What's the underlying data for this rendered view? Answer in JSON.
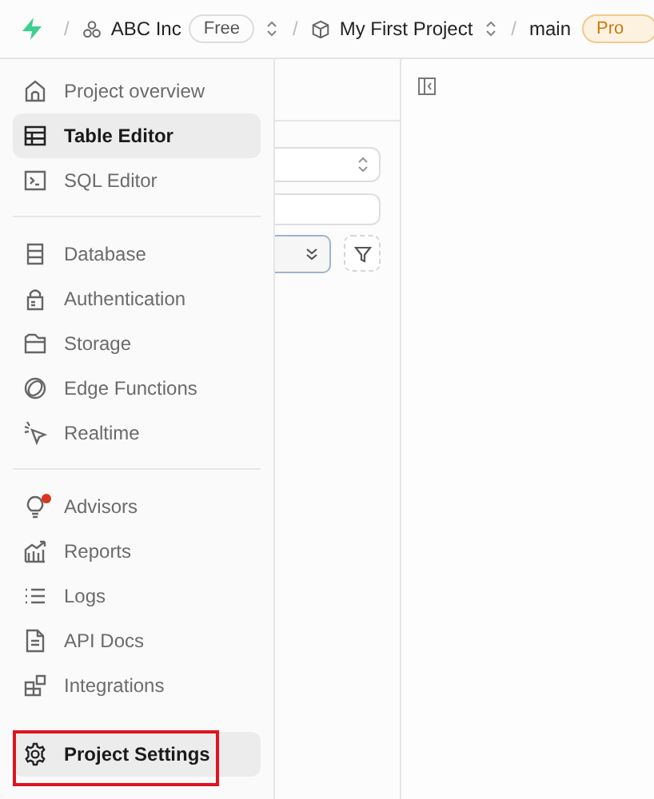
{
  "breadcrumb": {
    "separators": [
      "/",
      "/",
      "/"
    ],
    "org": {
      "name": "ABC Inc",
      "plan": "Free"
    },
    "project": {
      "name": "My First Project"
    },
    "branch": {
      "name": "main",
      "badge": "Pro"
    }
  },
  "sidebar": {
    "groups": [
      [
        {
          "label": "Project overview",
          "selected": false,
          "highlighted": false,
          "alert": false
        },
        {
          "label": "Table Editor",
          "selected": true,
          "highlighted": false,
          "alert": false
        },
        {
          "label": "SQL Editor",
          "selected": false,
          "highlighted": false,
          "alert": false
        }
      ],
      [
        {
          "label": "Database",
          "selected": false,
          "highlighted": false,
          "alert": false
        },
        {
          "label": "Authentication",
          "selected": false,
          "highlighted": false,
          "alert": false
        },
        {
          "label": "Storage",
          "selected": false,
          "highlighted": false,
          "alert": false
        },
        {
          "label": "Edge Functions",
          "selected": false,
          "highlighted": false,
          "alert": false
        },
        {
          "label": "Realtime",
          "selected": false,
          "highlighted": false,
          "alert": false
        }
      ],
      [
        {
          "label": "Advisors",
          "selected": false,
          "highlighted": false,
          "alert": true
        },
        {
          "label": "Reports",
          "selected": false,
          "highlighted": false,
          "alert": false
        },
        {
          "label": "Logs",
          "selected": false,
          "highlighted": false,
          "alert": false
        },
        {
          "label": "API Docs",
          "selected": false,
          "highlighted": false,
          "alert": false
        },
        {
          "label": "Integrations",
          "selected": false,
          "highlighted": false,
          "alert": false
        }
      ],
      [
        {
          "label": "Project Settings",
          "selected": true,
          "highlighted": true,
          "alert": false
        }
      ]
    ]
  }
}
